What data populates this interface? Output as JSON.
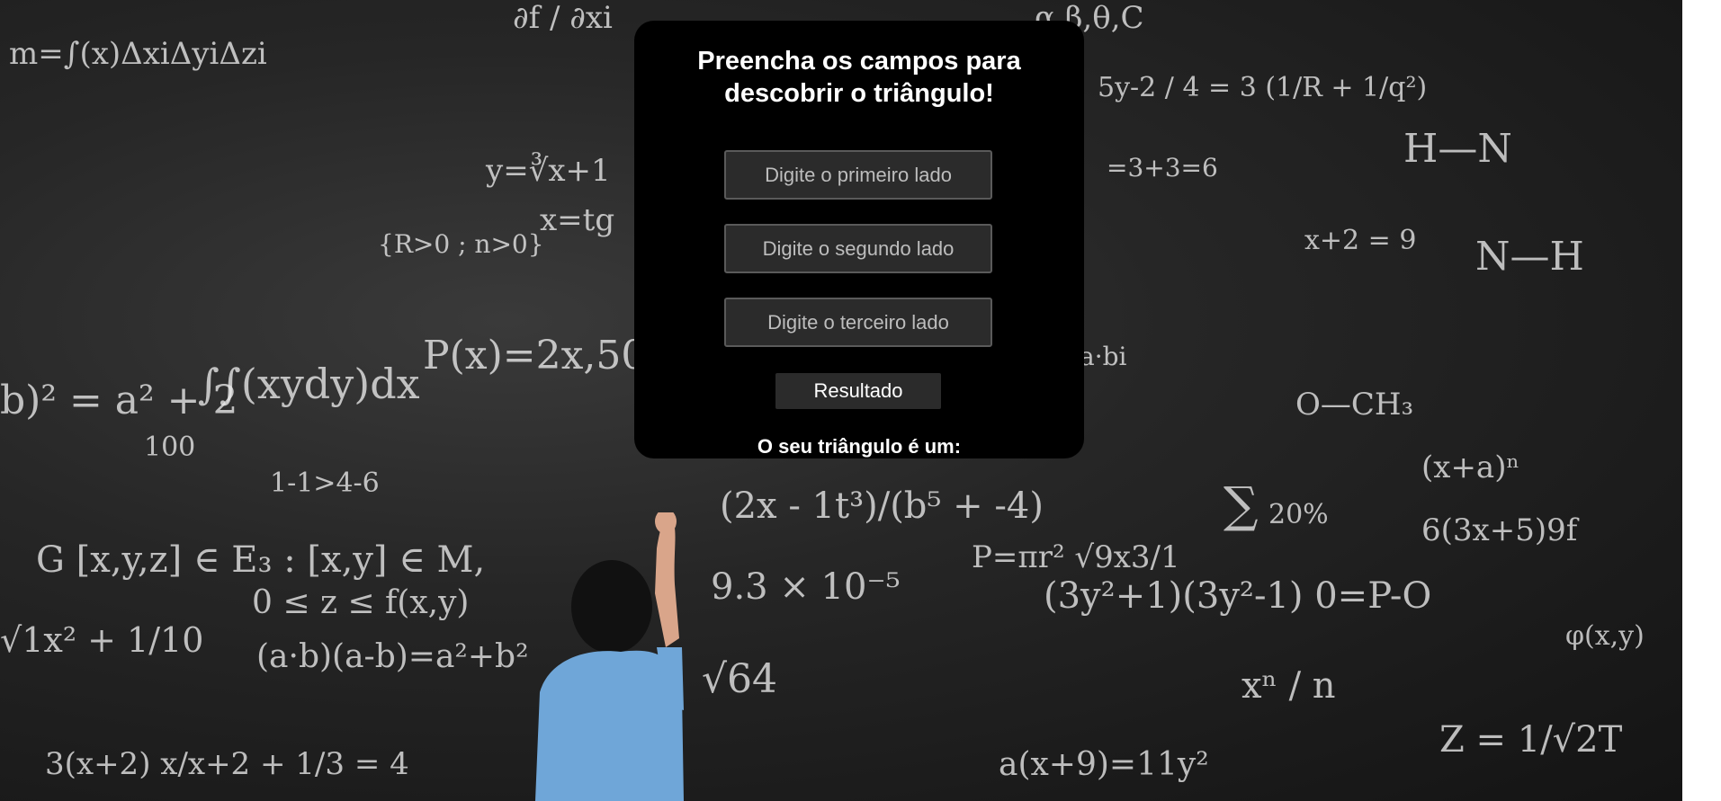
{
  "card": {
    "title": "Preencha os campos para descobrir o triângulo!",
    "fields": [
      {
        "placeholder": "Digite o primeiro lado"
      },
      {
        "placeholder": "Digite o segundo lado"
      },
      {
        "placeholder": "Digite o terceiro lado"
      }
    ],
    "button_label": "Resultado",
    "result_label": "O seu triângulo é um:"
  },
  "background": {
    "description_icon": "chalkboard-background"
  },
  "colors": {
    "card_bg": "#000000",
    "field_bg": "#2b2b2b",
    "text": "#ffffff"
  }
}
